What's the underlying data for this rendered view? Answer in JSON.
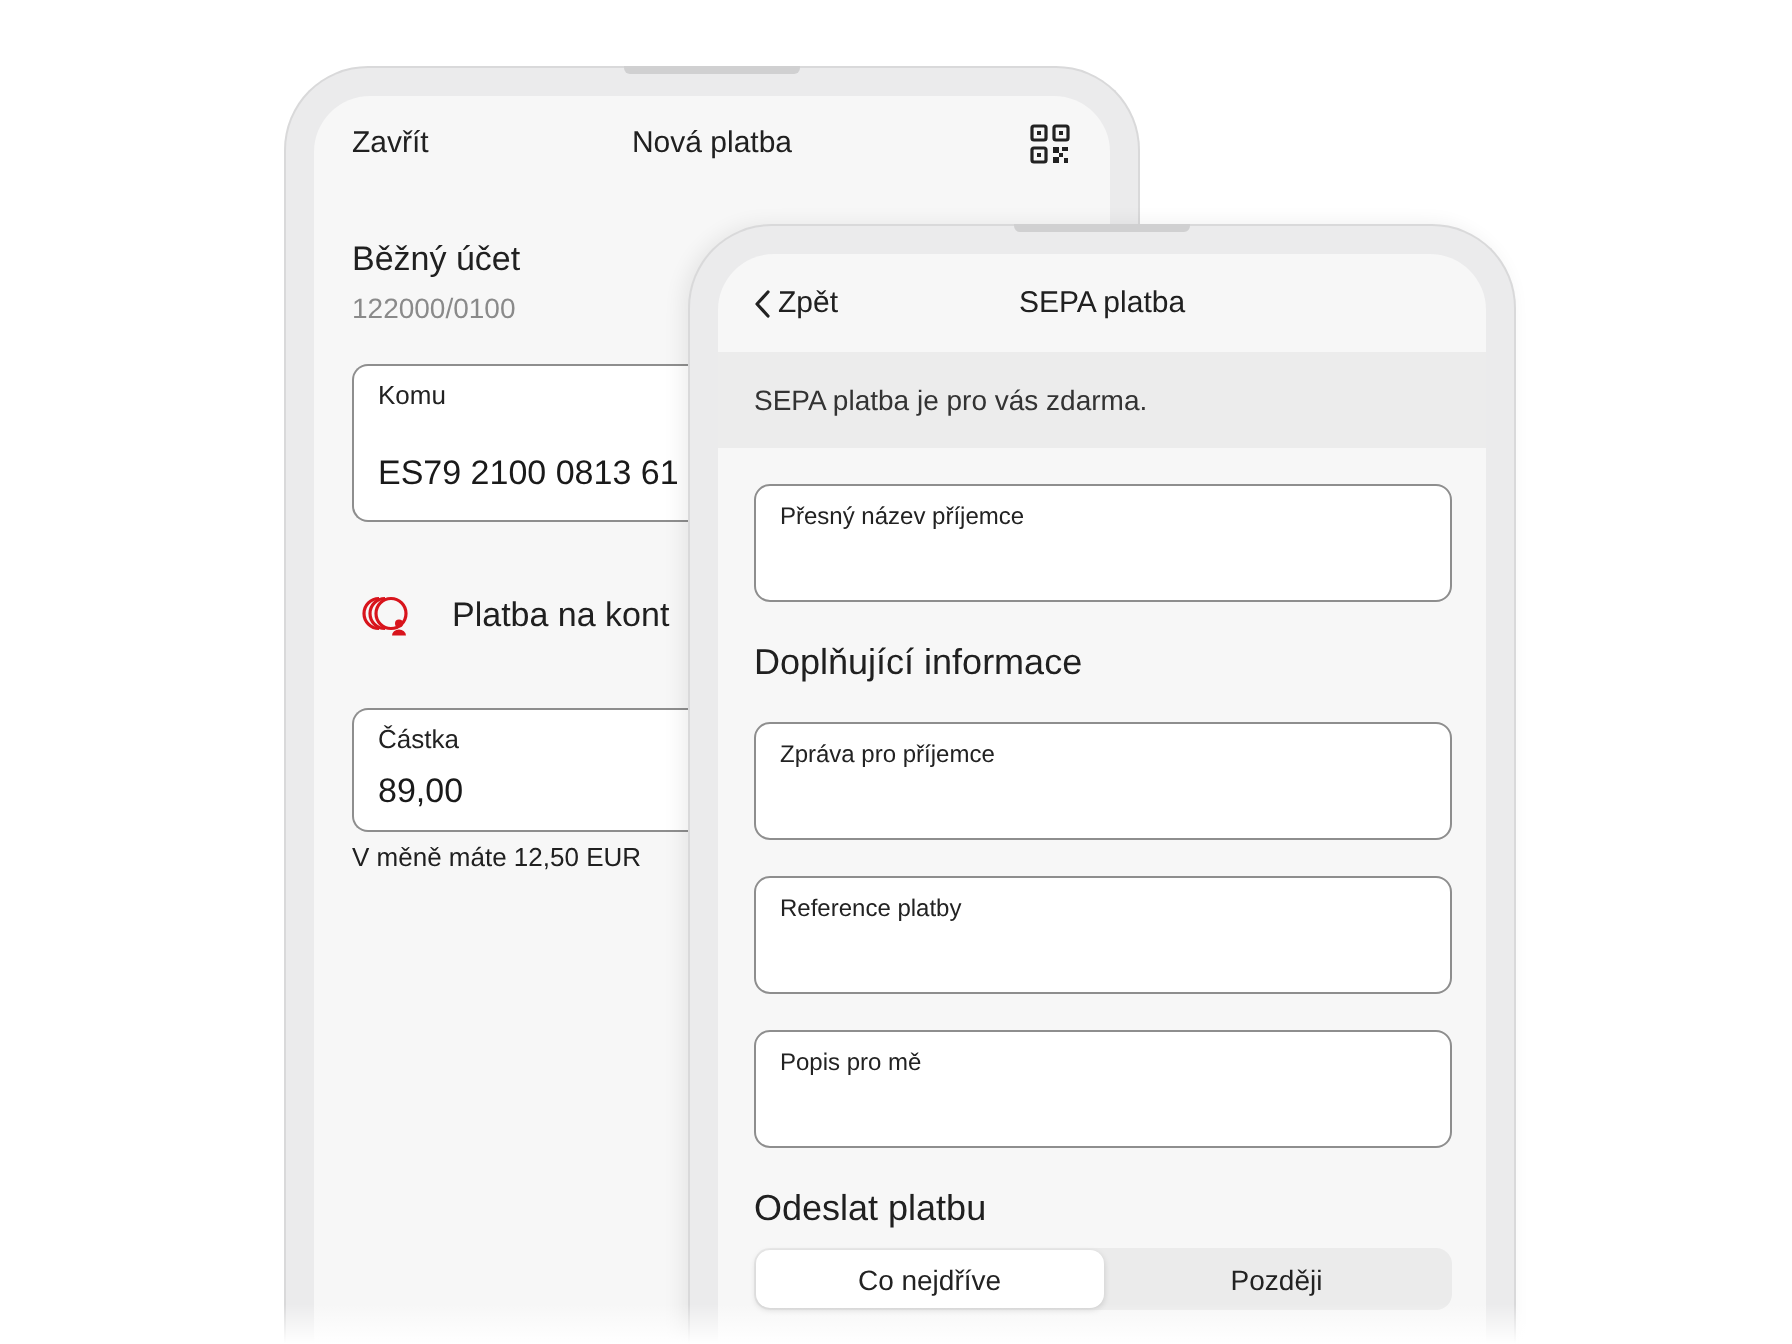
{
  "back_screen": {
    "header": {
      "close_label": "Zavřít",
      "title": "Nová platba"
    },
    "account": {
      "name": "Běžný účet",
      "number": "122000/0100"
    },
    "recipient_field": {
      "label": "Komu",
      "value": "ES79 2100 0813 61"
    },
    "contact_payment": {
      "label": "Platba na kont"
    },
    "amount_field": {
      "label": "Částka",
      "value": "89,00"
    },
    "balance_note": "V měně máte 12,50 EUR"
  },
  "front_screen": {
    "header": {
      "back_label": "Zpět",
      "title": "SEPA platba"
    },
    "notice": "SEPA platba je pro vás zdarma.",
    "content": [
      {
        "kind": "field",
        "label": "Přesný název příjemce"
      },
      {
        "kind": "heading",
        "text": "Doplňující informace"
      },
      {
        "kind": "field",
        "label": "Zpráva pro příjemce"
      },
      {
        "kind": "field",
        "label": "Reference platby"
      },
      {
        "kind": "field",
        "label": "Popis pro mě"
      },
      {
        "kind": "heading",
        "text": "Odeslat platbu"
      },
      {
        "kind": "segmented",
        "options": [
          {
            "label": "Co nejdříve",
            "selected": true
          },
          {
            "label": "Později",
            "selected": false
          }
        ]
      }
    ]
  }
}
